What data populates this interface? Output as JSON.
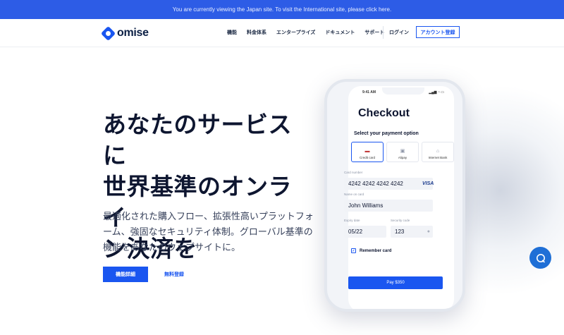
{
  "banner": {
    "text": "You are currently viewing the Japan site. To visit the International site, please click here."
  },
  "nav": {
    "logo": "omise",
    "links": [
      "機能",
      "料金体系",
      "エンタープライズ",
      "ドキュメント",
      "サポート"
    ],
    "login": "ログイン",
    "signup": "アカウント登録"
  },
  "hero": {
    "title_lines": [
      "あなたのサービスに",
      "世界基準のオンライ",
      "ン決済を"
    ],
    "subtitle_lines": [
      "最適化された購入フロー、拡張性高いプラットフォ",
      "ーム、強固なセキュリティ体制。グローバル基準の",
      "機能をあなたのウェブサイトに。"
    ],
    "cta_primary": "機能詳細",
    "cta_secondary": "無料登録"
  },
  "phone": {
    "time": "9:41 AM",
    "title": "Checkout",
    "payment_label": "Select your payment option",
    "methods": [
      {
        "label": "Credit card",
        "icon": "credit-card-icon"
      },
      {
        "label": "Alipay",
        "icon": "alipay-icon"
      },
      {
        "label": "Internet Bank",
        "icon": "bank-icon"
      }
    ],
    "card_number_label": "Card number",
    "card_number": "4242 4242 4242 4242",
    "card_brand": "VISA",
    "name_label": "Name on card",
    "name": "John Williams",
    "expiry_label": "Expiry date",
    "expiry": "05/22",
    "cvc_label": "Security code",
    "cvc": "123",
    "remember": "Remember card",
    "pay": "Pay $350"
  },
  "colors": {
    "brand": "#1a56f0",
    "banner": "#2d5ce6",
    "help": "#1f6fd6"
  }
}
